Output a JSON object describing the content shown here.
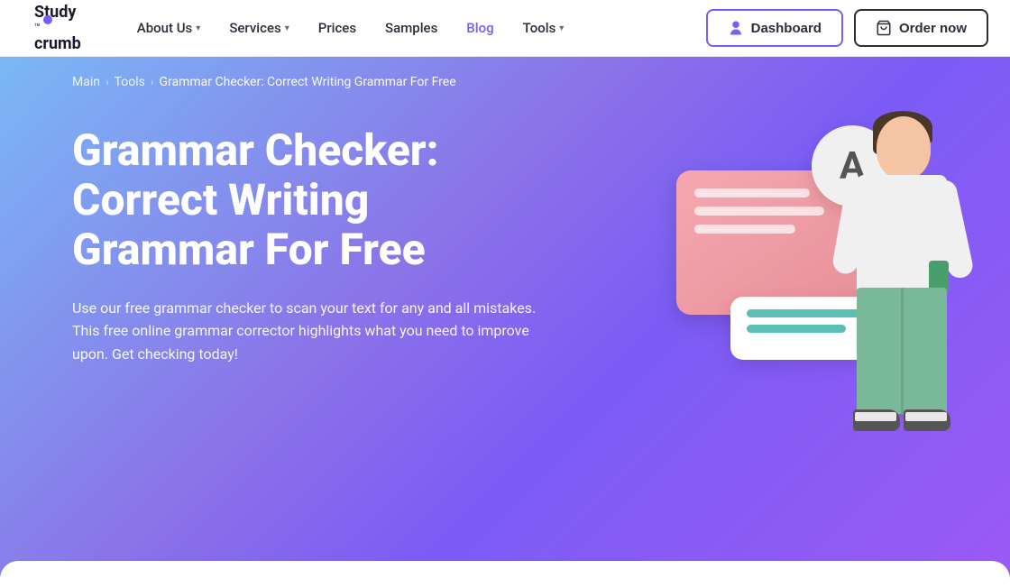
{
  "header": {
    "logo": {
      "name": "Study",
      "tm": "™",
      "name2": "crumb"
    },
    "nav": [
      {
        "id": "about-us",
        "label": "About Us",
        "hasDropdown": true
      },
      {
        "id": "services",
        "label": "Services",
        "hasDropdown": true
      },
      {
        "id": "prices",
        "label": "Prices",
        "hasDropdown": false
      },
      {
        "id": "samples",
        "label": "Samples",
        "hasDropdown": false
      },
      {
        "id": "blog",
        "label": "Blog",
        "hasDropdown": false,
        "isActive": true
      },
      {
        "id": "tools",
        "label": "Tools",
        "hasDropdown": true
      }
    ],
    "dashboard_label": "Dashboard",
    "order_label": "Order now"
  },
  "breadcrumb": {
    "items": [
      {
        "label": "Main",
        "id": "main"
      },
      {
        "label": "Tools",
        "id": "tools"
      },
      {
        "label": "Grammar Checker: Correct Writing Grammar For Free",
        "id": "current"
      }
    ]
  },
  "hero": {
    "title": "Grammar Checker: Correct Writing Grammar For Free",
    "description": "Use our free grammar checker to scan your text for any and all mistakes. This free online grammar corrector highlights what you need to improve upon. Get checking today!",
    "illustration_letter": "A"
  }
}
